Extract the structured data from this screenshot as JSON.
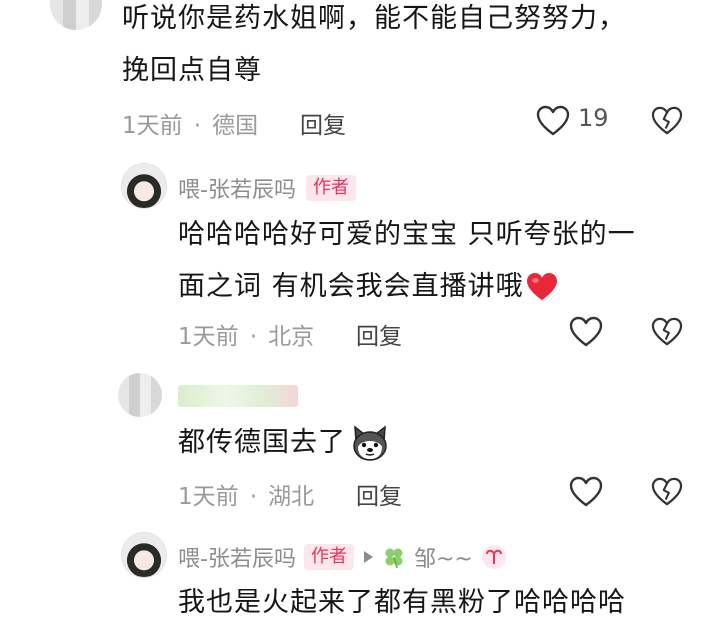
{
  "comment_1": {
    "text_line1": "听说你是药水姐啊，能不能自己努努力，",
    "text_line2": "挽回点自尊",
    "time": "1天前",
    "dot": "·",
    "location": "德国",
    "reply_label": "回复",
    "like_count": "19"
  },
  "reply_1": {
    "username": "喂-张若辰吗",
    "author_badge": "作者",
    "text_line1": "哈哈哈哈好可爱的宝宝 只听夸张的一",
    "text_line2": "面之词 有机会我会直播讲哦",
    "time": "1天前",
    "dot": "·",
    "location": "北京",
    "reply_label": "回复"
  },
  "reply_2": {
    "text": "都传德国去了",
    "time": "1天前",
    "dot": "·",
    "location": "湖北",
    "reply_label": "回复"
  },
  "reply_3": {
    "username": "喂-张若辰吗",
    "author_badge": "作者",
    "reply_to": "邹~~",
    "text": "我也是火起来了都有黑粉了哈哈哈哈"
  },
  "colors": {
    "badge_text": "#e8335a",
    "badge_bg": "#fde6ec",
    "meta_gray": "#9a9a9a",
    "heart_red": "#e8283a"
  },
  "icons": [
    "heart-outline-icon",
    "broken-heart-icon",
    "red-heart-emoji",
    "husky-emoji",
    "play-arrow-icon",
    "clover-icon",
    "aries-icon"
  ]
}
